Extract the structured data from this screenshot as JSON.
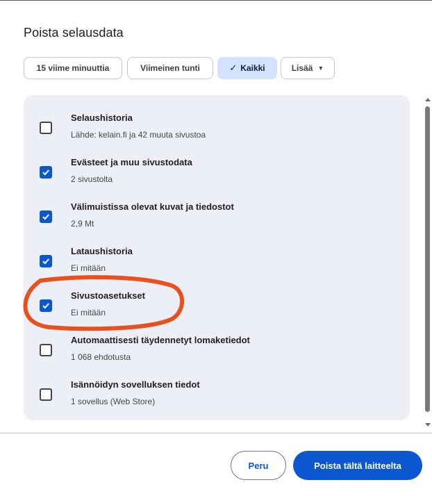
{
  "dialog": {
    "title": "Poista selausdata"
  },
  "time_chips": [
    {
      "label": "15 viime minuuttia",
      "selected": false
    },
    {
      "label": "Viimeinen tunti",
      "selected": false
    },
    {
      "label": "Kaikki",
      "selected": true
    },
    {
      "label": "Lisää",
      "selected": false
    }
  ],
  "items": [
    {
      "title": "Selaushistoria",
      "subtitle": "Lähde: kelain.fi ja 42 muuta sivustoa",
      "checked": false
    },
    {
      "title": "Evästeet ja muu sivustodata",
      "subtitle": "2 sivustolta",
      "checked": true
    },
    {
      "title": "Välimuistissa olevat kuvat ja tiedostot",
      "subtitle": "2,9 Mt",
      "checked": true
    },
    {
      "title": "Lataushistoria",
      "subtitle": "Ei mitään",
      "checked": true
    },
    {
      "title": "Sivustoasetukset",
      "subtitle": "Ei mitään",
      "checked": true
    },
    {
      "title": "Automaattisesti täydennetyt lomaketiedot",
      "subtitle": "1 068 ehdotusta",
      "checked": false
    },
    {
      "title": "Isännöidyn sovelluksen tiedot",
      "subtitle": "1 sovellus (Web Store)",
      "checked": false
    }
  ],
  "buttons": {
    "cancel": "Peru",
    "delete": "Poista tältä laitteelta"
  },
  "colors": {
    "accent": "#0b57d0",
    "chip_selected": "#d3e3fd",
    "panel_bg": "#eceff5",
    "annotation": "#e8501f"
  },
  "icons": {
    "checkmark": "check-icon",
    "dropdown": "caret-down-icon"
  }
}
